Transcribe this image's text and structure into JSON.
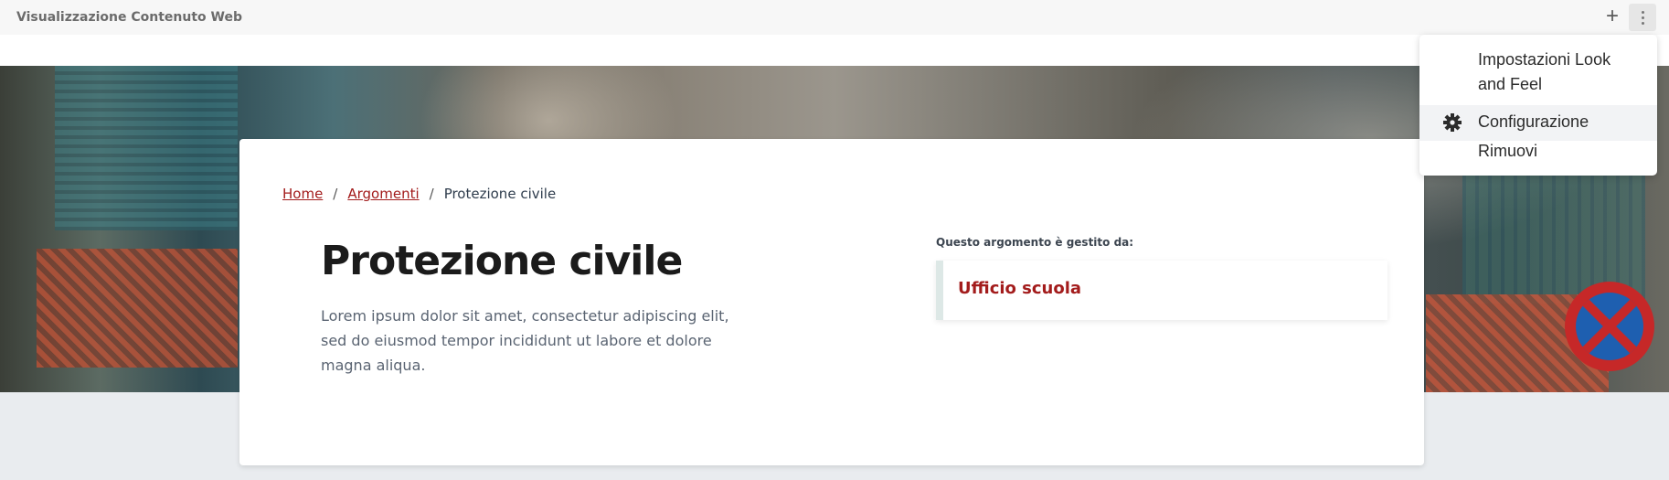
{
  "topbar": {
    "portlet_title": "Visualizzazione Contenuto Web",
    "add_icon": "plus-icon",
    "options_icon": "kebab-vertical-icon"
  },
  "breadcrumb": {
    "items": [
      "Home",
      "Argomenti",
      "Protezione civile"
    ],
    "separator": "/"
  },
  "main": {
    "title": "Protezione civile",
    "description": "Lorem ipsum dolor sit amet, consectetur adipiscing elit, sed do eiusmod tempor incididunt ut labore et dolore magna aliqua.",
    "managed_label": "Questo argomento è gestito da:",
    "office_link": "Ufficio scuola"
  },
  "menu": {
    "items": [
      {
        "label": "Impostazioni Look and Feel",
        "icon": ""
      },
      {
        "label": "Configurazione",
        "icon": "gear-icon"
      },
      {
        "label": "Rimuovi",
        "icon": ""
      }
    ]
  },
  "colors": {
    "accent": "#a31c1c",
    "topbar_bg": "#f7f7f7",
    "page_bg": "#e9ecef"
  }
}
